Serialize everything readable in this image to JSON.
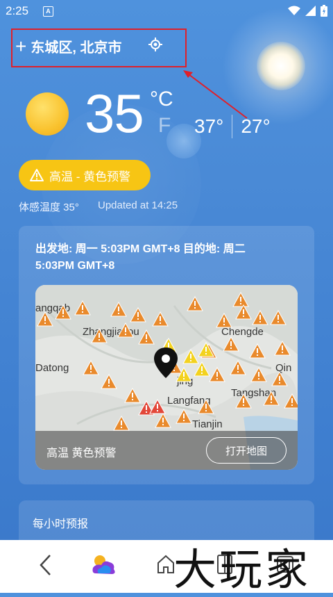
{
  "status_bar": {
    "time": "2:25",
    "notification_badge": "A"
  },
  "location": {
    "text": "东城区, 北京市",
    "add_symbol": "+"
  },
  "current": {
    "temperature": "35",
    "unit_c": "°C",
    "unit_f": "F",
    "high": "37°",
    "low": "27°",
    "feels_like": "体感温度 35°",
    "updated": "Updated at 14:25"
  },
  "alert": {
    "label": "高温 - 黄色预警",
    "color": "#f7c514"
  },
  "map_card": {
    "route_text": "出发地: 周一 5:03PM GMT+8 目的地: 周二 5:03PM GMT+8",
    "map_labels": [
      "angqab",
      "Zhangjiakou",
      "Chengde",
      "Datong",
      "jing",
      "Langfang",
      "Tangshan",
      "Qin",
      "Tianjin"
    ],
    "footer_label": "高温 黄色预警",
    "open_map_button": "打开地图"
  },
  "hourly": {
    "title": "每小时预报"
  },
  "watermark": "大玩家",
  "icons": [
    "sun-icon",
    "location-target-icon",
    "warning-triangle-icon",
    "map-pin-icon",
    "back-icon",
    "weather-app-icon",
    "home-icon",
    "recent-apps-icon",
    "menu-icon",
    "wifi-icon",
    "signal-icon",
    "battery-icon"
  ]
}
